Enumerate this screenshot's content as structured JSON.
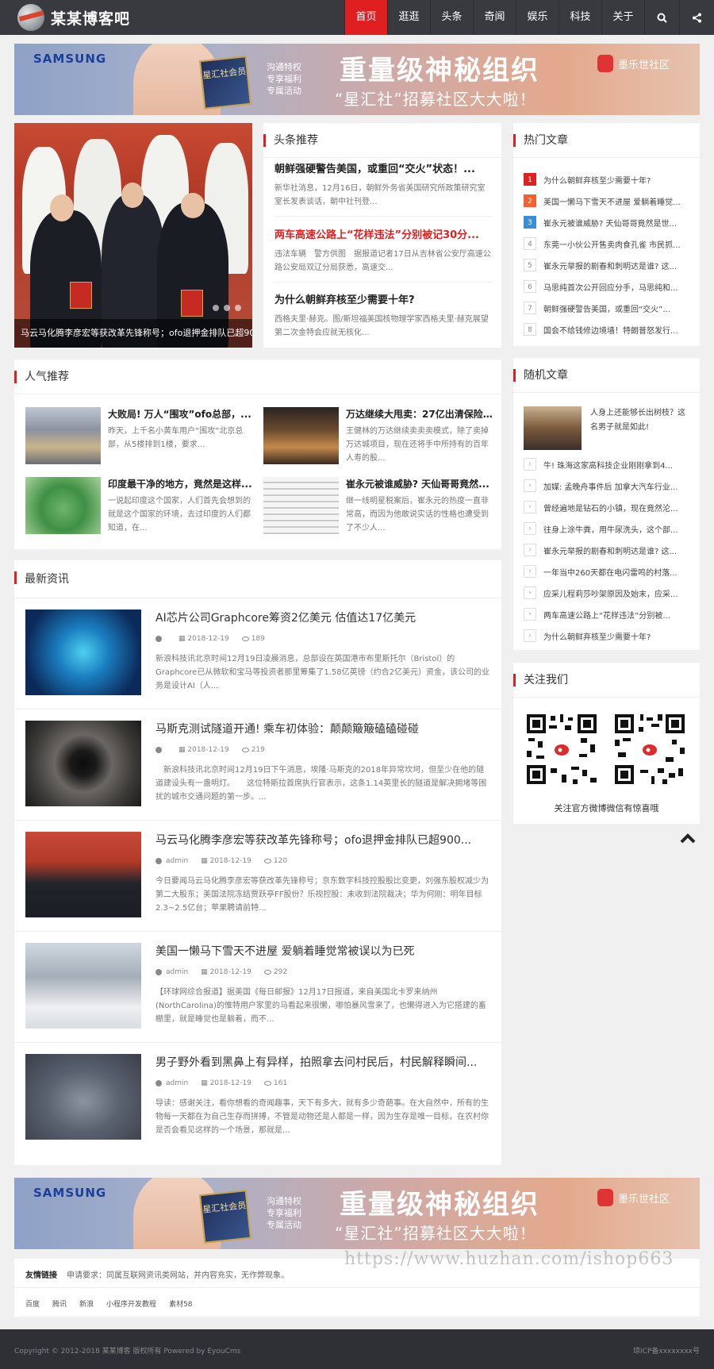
{
  "site": {
    "name": "某某博客吧"
  },
  "nav": {
    "items": [
      "首页",
      "逛逛",
      "头条",
      "奇闻",
      "娱乐",
      "科技",
      "关于"
    ],
    "active_index": 0
  },
  "banner": {
    "brand_left": "SAMSUNG",
    "card_text": "星汇社会员",
    "promo_lines": [
      "沟通特权",
      "专享福利",
      "专属活动"
    ],
    "headline": "重量级神秘组织",
    "subline": "“星汇社”招募社区大大啦！",
    "brand_right": "墨乐世社区"
  },
  "slider": {
    "caption": "马云马化腾李彦宏等获改革先锋称号；ofo退押金排队已超90..."
  },
  "headlines": {
    "title": "头条推荐",
    "items": [
      {
        "title": "朝鲜强硬警告美国，或重回“交火”状态！...",
        "summary": "新华社消息，12月16日，朝鲜外务省美国研究所政策研究室室长发表谈话，朝中社刊登..."
      },
      {
        "title": "两车高速公路上“花样违法”分别被记30分...",
        "summary": "违法车辆　警方供图　据报道记者17日从吉林省公安厅高速公路公安局双辽分局获悉，高速交..."
      },
      {
        "title": "为什么朝鲜弃核至少需要十年?",
        "summary": "西格夫里·赫克。图/斯坦福美国核物理学家西格夫里·赫克展望第二次金特会应就无核化..."
      }
    ]
  },
  "hot": {
    "title": "热门文章",
    "items": [
      "为什么朝鲜弃核至少需要十年?",
      "美国一懒马下雪天不进屋 爱躺着睡觉...",
      "崔永元被谁威胁? 天仙哥哥竟然是世...",
      "东莞一小伙公开售卖肉食孔雀 市民抓...",
      "崔永元举报的剧春和刺明达是谁? 这...",
      "马思纯首次公开回应分手，马思纯和...",
      "朝鲜强硬警告美国，或重回“交火”...",
      "国会不给钱修边境墙！特朗普怒发行..."
    ]
  },
  "popular": {
    "title": "人气推荐",
    "items": [
      {
        "title": "大败局! 万人“围攻”ofo总部，...",
        "summary": "昨天，上千名小黄车用户“围攻”北京总部，从5楼排到1楼，要求..."
      },
      {
        "title": "万达继续大甩卖：27亿出清保险...",
        "summary": "王健林的万达继续卖卖卖模式，除了卖掉万达城项目，现在还将手中所持有的百年人寿的股..."
      },
      {
        "title": "印度最干净的地方，竟然是这样...",
        "summary": "一说起印度这个国家，人们首先会想到的就是这个国家的环境，去过印度的人们都知道，在..."
      },
      {
        "title": "崔永元被谁威胁? 天仙哥哥竟然...",
        "summary": "继一线明星税案后，崔永元的热度一直非常高，而因为他敢说实话的性格也遭受到了不少人..."
      }
    ]
  },
  "latest": {
    "title": "最新资讯",
    "items": [
      {
        "title": "AI芯片公司Graphcore筹资2亿美元 估值达17亿美元",
        "author": "",
        "date": "2018-12-19",
        "views": "189",
        "summary": "新浪科技讯北京时间12月19日凌晨消息，总部设在英国港市布里斯托尔（Bristol）的Graphcore已从微软和宝马等投资者那里筹集了1.58亿英镑（约合2亿美元）资金，该公司的业务是设计AI（人..."
      },
      {
        "title": "马斯克测试隧道开通! 乘车初体验：颠颠簸簸磕磕碰碰",
        "author": "",
        "date": "2018-12-19",
        "views": "219",
        "summary": "　新浪科技讯北京时间12月19日下午消息，埃隆·马斯克的2018年异常坎坷，但至少在他的隧道建设头有一盏明灯。　　这位特斯拉首席执行官表示，这条1.14英里长的隧道是解决拥堵等困扰的城市交通问题的第一步。..."
      },
      {
        "title": "马云马化腾李彦宏等获改革先锋称号；ofo退押金排队已超900...",
        "author": "admin",
        "date": "2018-12-19",
        "views": "120",
        "summary": "今日要闻马云马化腾李彦宏等获改革先锋称号；京东数字科技控股股比变更，刘强东股权减少为第二大股东；美国法院冻结贾跃亭FF股份？乐视控股：未收到法院裁决；华为何刚：明年目标2.3~2.5亿台；苹果聘请前特..."
      },
      {
        "title": "美国一懒马下雪天不进屋 爱躺着睡觉常被误以为已死",
        "author": "admin",
        "date": "2018-12-19",
        "views": "292",
        "summary": "【环球网综合报道】据美国《每日邮报》12月17日报道，来自美国北卡罗来纳州(NorthCarolina)的惟特用户家里的马看起来很懒，哪怕暴风雪来了，也懒得进入为它搭建的畜棚里，就是睡觉也是躺着，而不..."
      },
      {
        "title": "男子野外看到黑鼻上有异样，拍照拿去问村民后，村民解释瞬间...",
        "author": "admin",
        "date": "2018-12-19",
        "views": "161",
        "summary": "导读：感谢关注，看你想看的奇闻趣事，天下有多大，就有多少奇葩事。在大自然中，所有的生物每一天都在为自己生存而拼搏，不管是动物还是人都是一样，因为生存是唯一目标，在农村你是否会看见这样的一个场景，那就是..."
      }
    ]
  },
  "random": {
    "title": "随机文章",
    "featured": "人身上还能够长出树枝？这名男子就是如此!",
    "items": [
      "牛! 珠海这家高科技企业刚刚拿到4...",
      "加媒: 孟晚舟事件后 加拿大汽车行业...",
      "曾经遍地是钻石的小镇，现在竟然沦...",
      "往身上涂牛粪，用牛尿洗头，这个部...",
      "崔永元举报的剧春和刺明达是谁? 这...",
      "一年当中260天都在电闪雷鸣的村落...",
      "应采儿程莉莎吵架原因及始末，应采...",
      "两车高速公路上“花样违法”分别被...",
      "为什么朝鲜弃核至少需要十年?"
    ]
  },
  "follow": {
    "title": "关注我们",
    "caption": "关注官方微博微信有惊喜哦"
  },
  "links": {
    "label": "友情链接",
    "requirement": "申请要求：同属互联网资讯类网站，并内容充实，无作弊现象。",
    "items": [
      "百度",
      "腾讯",
      "新浪",
      "小程序开发教程",
      "素材58"
    ]
  },
  "watermark": "https://www.huzhan.com/ishop663",
  "footer": {
    "copyright": "Copyright © 2012-2018 某某博客 版权所有 Powered by EyouCms",
    "icp": "琼ICP备xxxxxxxx号"
  },
  "colors": {
    "accent": "#e02020",
    "topbar": "#383a3f",
    "footer": "#2e3035"
  }
}
